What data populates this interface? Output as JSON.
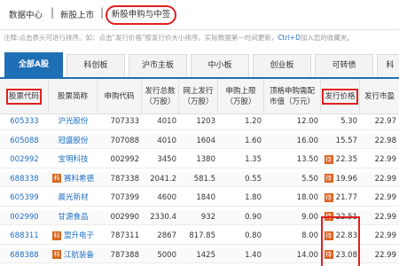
{
  "breadcrumb": {
    "items": [
      "数据中心",
      "新股上市"
    ],
    "separator": "|",
    "current": "新股申购与中签"
  },
  "note": {
    "text_before": "注释:点击表头可进行排序。如：点击\"发行价格\"按发行价大小排序。实际数据第一时间更新，",
    "highlight": "Ctrl+D",
    "text_after": "加入您的收藏夹。"
  },
  "tabs": [
    {
      "label": "全部A股",
      "active": true
    },
    {
      "label": "科创板",
      "active": false
    },
    {
      "label": "沪市主板",
      "active": false
    },
    {
      "label": "中小板",
      "active": false
    },
    {
      "label": "创业板",
      "active": false
    },
    {
      "label": "可转债",
      "active": false
    },
    {
      "label": "科",
      "active": false
    }
  ],
  "table": {
    "headers": [
      "股票代码",
      "股票简称",
      "申购代码",
      "发行总数\n（万股）",
      "网上发行\n（万股）",
      "申购上限\n（万股）",
      "顶格申购需配\n市值（万元）",
      "发行价格",
      "发行市盈"
    ],
    "rows": [
      {
        "code": "605333",
        "tag": "",
        "name": "沪光股份",
        "sub": "707333",
        "total": "4010",
        "online": "1203",
        "limit": "1.20",
        "cap": "12.00",
        "ptag": "",
        "price": "5.30",
        "pe": "22.97"
      },
      {
        "code": "605088",
        "tag": "",
        "name": "冠盛股份",
        "sub": "707088",
        "total": "4010",
        "online": "1604",
        "limit": "1.60",
        "cap": "16.00",
        "ptag": "",
        "price": "15.57",
        "pe": "22.98"
      },
      {
        "code": "002992",
        "tag": "",
        "name": "宝明科技",
        "sub": "002992",
        "total": "3450",
        "online": "1380",
        "limit": "1.35",
        "cap": "13.50",
        "ptag": "待",
        "price": "22.35",
        "pe": "22.99"
      },
      {
        "code": "688338",
        "tag": "科",
        "name": "赛科希德",
        "sub": "787338",
        "total": "2041.2",
        "online": "581.5",
        "limit": "0.55",
        "cap": "5.50",
        "ptag": "待",
        "price": "19.96",
        "pe": "22.99"
      },
      {
        "code": "605399",
        "tag": "",
        "name": "晨光新材",
        "sub": "707399",
        "total": "4600",
        "online": "1840",
        "limit": "1.80",
        "cap": "18.00",
        "ptag": "待",
        "price": "21.77",
        "pe": "22.99"
      },
      {
        "code": "002990",
        "tag": "",
        "name": "甘源食品",
        "sub": "002990",
        "total": "2330.4",
        "online": "932",
        "limit": "0.90",
        "cap": "9.00",
        "ptag": "待",
        "price": "22.51",
        "pe": "22.99"
      },
      {
        "code": "688311",
        "tag": "科",
        "name": "盟升电子",
        "sub": "787311",
        "total": "2867",
        "online": "817.85",
        "limit": "0.80",
        "cap": "8.00",
        "ptag": "待",
        "price": "22.83",
        "pe": "22.99"
      },
      {
        "code": "688388",
        "tag": "科",
        "name": "江航装备",
        "sub": "787388",
        "total": "5000",
        "online": "1425",
        "limit": "1.40",
        "cap": "14.00",
        "ptag": "待",
        "price": "23.08",
        "pe": "22.99"
      }
    ]
  }
}
